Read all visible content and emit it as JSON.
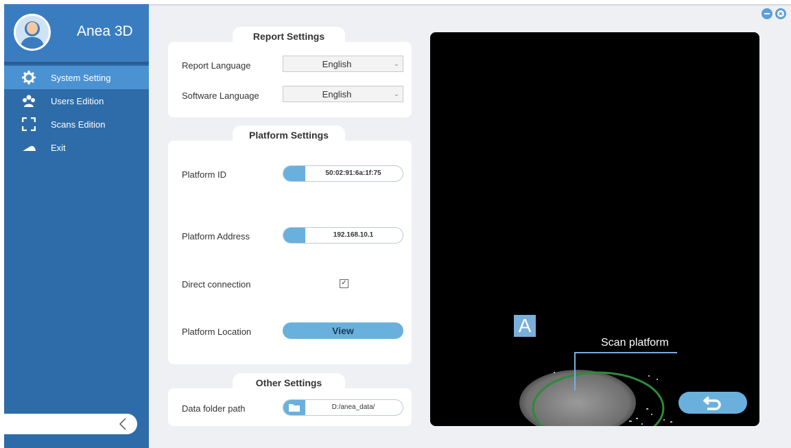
{
  "app": {
    "name": "Anea 3D"
  },
  "sidebar": {
    "items": [
      {
        "label": "System Setting",
        "icon": "gear-icon",
        "active": true
      },
      {
        "label": "Users Edition",
        "icon": "users-icon",
        "active": false
      },
      {
        "label": "Scans Edition",
        "icon": "scan-frame-icon",
        "active": false
      },
      {
        "label": "Exit",
        "icon": "exit-icon",
        "active": false
      }
    ]
  },
  "report_settings": {
    "title": "Report Settings",
    "report_language_label": "Report Language",
    "report_language_value": "English",
    "software_language_label": "Software Language",
    "software_language_value": "English"
  },
  "platform_settings": {
    "title": "Platform Settings",
    "platform_id_label": "Platform ID",
    "platform_id_value": "50:02:91:6a:1f:75",
    "platform_address_label": "Platform Address",
    "platform_address_value": "192.168.10.1",
    "direct_connection_label": "Direct connection",
    "direct_connection_checked": true,
    "platform_location_label": "Platform Location",
    "view_label": "View"
  },
  "other_settings": {
    "title": "Other Settings",
    "data_folder_label": "Data folder path",
    "data_folder_value": "D:/anea_data/"
  },
  "preview": {
    "marker": "A",
    "scan_platform_label": "Scan platform"
  },
  "colors": {
    "sidebar": "#2e6ca9",
    "sidebar_active": "#4b92d3",
    "accent": "#6ab0dd",
    "minimize": "#5b9fd6",
    "close": "#5b9fd6"
  }
}
